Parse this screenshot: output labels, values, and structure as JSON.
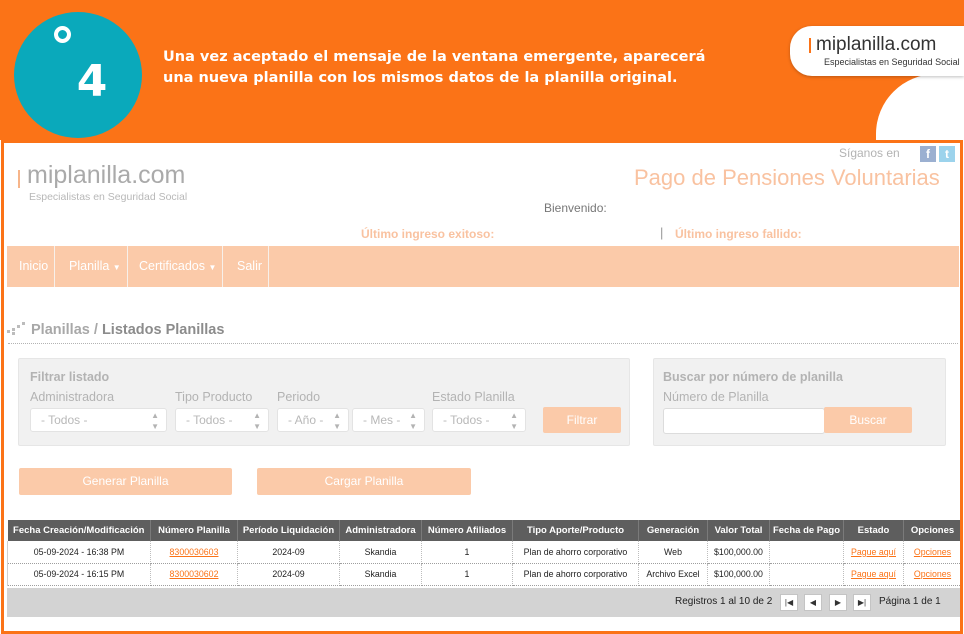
{
  "banner": {
    "step_number": "4",
    "text": "Una vez aceptado el mensaje de la ventana emergente, aparecerá una nueva planilla con los mismos datos de la planilla original.",
    "logo_main": "miplanilla.com",
    "logo_sub": "Especialistas en Seguridad Social"
  },
  "header": {
    "logo_main": "miplanilla.com",
    "logo_sub": "Especialistas en Seguridad Social",
    "follow_text": "Síganos en",
    "social_icons": [
      "facebook-icon",
      "twitter-icon"
    ],
    "page_title": "Pago de Pensiones Voluntarias",
    "welcome": "Bienvenido:",
    "last_login_ok": "Último ingreso exitoso:",
    "last_login_fail": "Último ingreso fallido:",
    "separator": "|"
  },
  "nav": {
    "items": [
      "Inicio",
      "Planilla",
      "Certificados",
      "Salir"
    ],
    "caret": "▼"
  },
  "breadcrumb": {
    "root": "Planillas",
    "sep": "/",
    "current": "Listados Planillas"
  },
  "filter": {
    "title": "Filtrar listado",
    "admin_label": "Administradora",
    "admin_value": "- Todos -",
    "product_label": "Tipo Producto",
    "product_value": "- Todos -",
    "period_label": "Periodo",
    "year_value": "- Año -",
    "month_value": "- Mes -",
    "status_label": "Estado Planilla",
    "status_value": "- Todos -",
    "filter_button": "Filtrar"
  },
  "search": {
    "title": "Buscar por número de planilla",
    "label": "Número de Planilla",
    "value": "",
    "button": "Buscar"
  },
  "actions": {
    "generate": "Generar Planilla",
    "upload": "Cargar Planilla"
  },
  "table": {
    "headers": [
      "Fecha Creación/Modificación",
      "Número Planilla",
      "Período Liquidación",
      "Administradora",
      "Número Afiliados",
      "Tipo Aporte/Producto",
      "Generación",
      "Valor Total",
      "Fecha de Pago",
      "Estado",
      "Opciones"
    ],
    "rows": [
      [
        "05-09-2024 - 16:38 PM",
        "8300030603",
        "2024-09",
        "Skandia",
        "1",
        "Plan de ahorro corporativo",
        "Web",
        "$100,000.00",
        "",
        "Pague aquí",
        "Opciones"
      ],
      [
        "05-09-2024 - 16:15 PM",
        "8300030602",
        "2024-09",
        "Skandia",
        "1",
        "Plan de ahorro corporativo",
        "Archivo Excel",
        "$100,000.00",
        "",
        "Pague aquí",
        "Opciones"
      ]
    ]
  },
  "pager": {
    "records": "Registros 1 al 10 de 2",
    "page": "Página 1 de 1",
    "first": "|◀",
    "prev": "◀",
    "next": "▶",
    "last": "▶|"
  },
  "colors": {
    "brand_orange": "#fb7317",
    "teal": "#0aa9bb",
    "nav_peach": "#fbcaa9",
    "table_header": "#5e5e5e"
  }
}
